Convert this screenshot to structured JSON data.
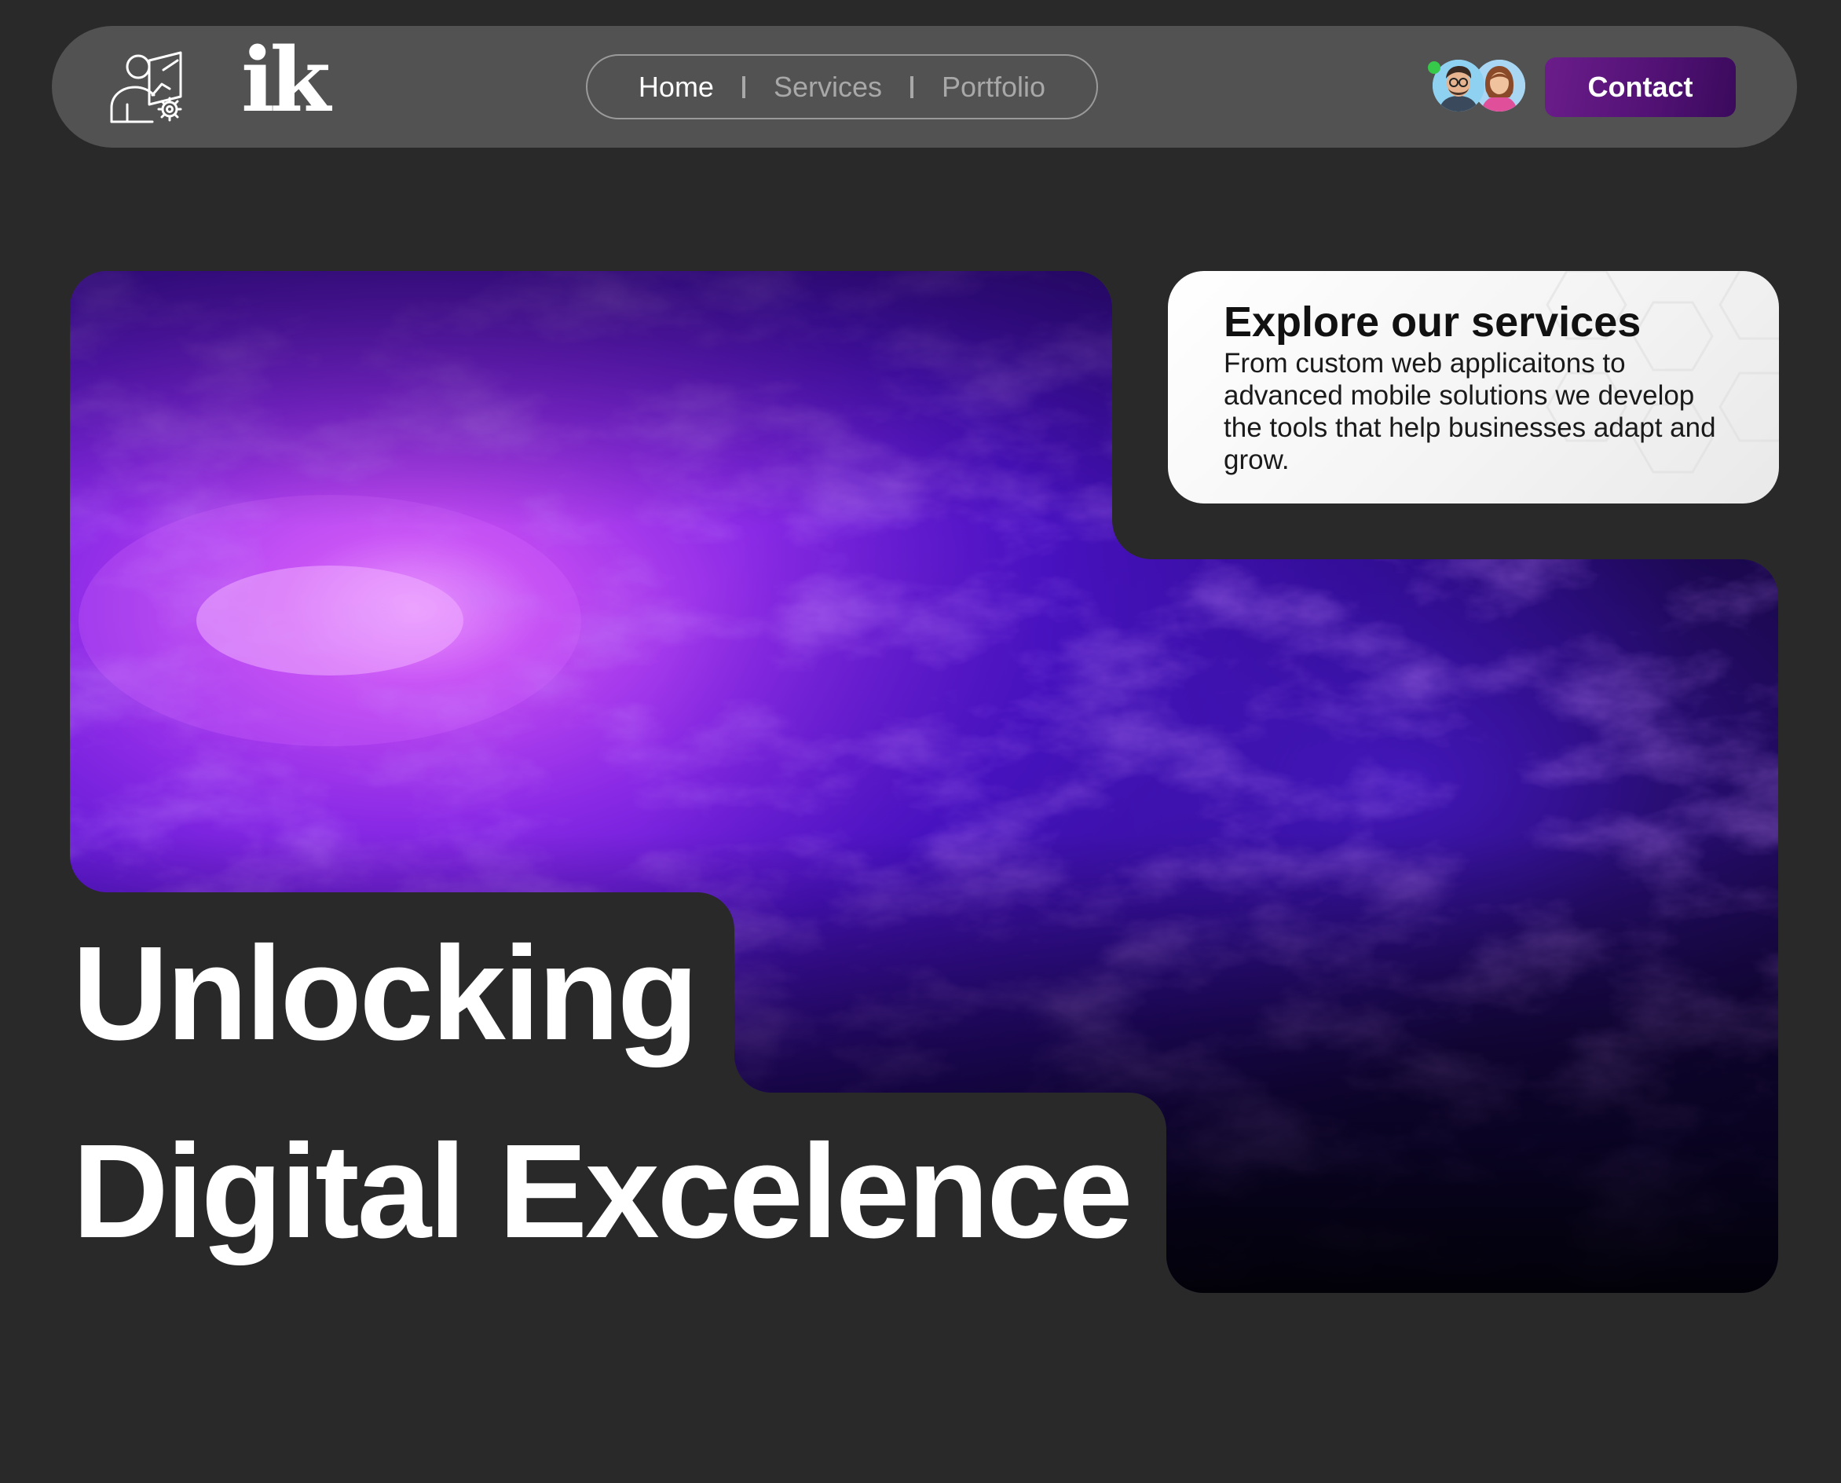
{
  "header": {
    "logo": {
      "text": "ik",
      "icon": "designer-gear-icon"
    },
    "nav": {
      "items": [
        {
          "label": "Home",
          "active": true
        },
        {
          "label": "Services",
          "active": false
        },
        {
          "label": "Portfolio",
          "active": false
        }
      ]
    },
    "team_avatars": [
      {
        "icon": "avatar-man-glasses"
      },
      {
        "icon": "avatar-woman"
      }
    ],
    "contact_label": "Contact"
  },
  "services_card": {
    "title": "Explore our services",
    "description": "From custom web applicaitons to advanced mobile solutions we develop the tools that help businesses adapt and grow."
  },
  "hero": {
    "headline_line1": "Unlocking",
    "headline_line2": "Digital Excelence",
    "image": "purple-nebula"
  },
  "colors": {
    "background": "#292929",
    "navbar": "#525252",
    "accent": "#5a1680",
    "nebula_bright": "#c04ef0",
    "nebula_deep": "#2a0a8a"
  }
}
